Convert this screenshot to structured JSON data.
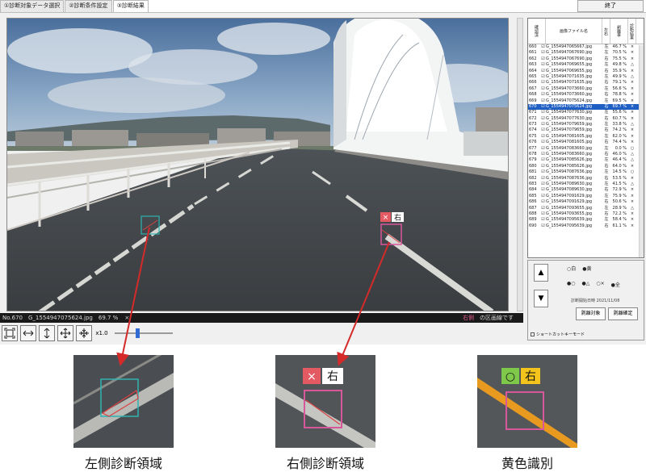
{
  "tabs": [
    "①診断対象データ選択",
    "②診断条件設定",
    "③診断結果"
  ],
  "end_button": "終了",
  "overlay": {
    "label_x": "×",
    "label_side": "右"
  },
  "status": {
    "info": "No.670　G_1554947075624.jpg　69.7 %",
    "close": "×",
    "warn_side": "右側",
    "warn_rest": " の区画線です"
  },
  "toolbar": {
    "zoom_label": "x1.0"
  },
  "list": {
    "headers": [
      "確認済",
      "画像ファイル名",
      "左右",
      "剥離率",
      "診断結果"
    ],
    "rows": [
      {
        "no": "660",
        "file": "G_1554947065667.jpg",
        "side": "左",
        "score": "46.7 %",
        "mark": "×"
      },
      {
        "no": "661",
        "file": "G_1554947067690.jpg",
        "side": "左",
        "score": "70.5 %",
        "mark": "×"
      },
      {
        "no": "662",
        "file": "G_1554947067690.jpg",
        "side": "右",
        "score": "75.5 %",
        "mark": "×"
      },
      {
        "no": "663",
        "file": "G_1554947069655.jpg",
        "side": "左",
        "score": "49.8 %",
        "mark": "△"
      },
      {
        "no": "664",
        "file": "G_1554947069655.jpg",
        "side": "右",
        "score": "35.9 %",
        "mark": "×"
      },
      {
        "no": "665",
        "file": "G_1554947071635.jpg",
        "side": "左",
        "score": "49.9 %",
        "mark": "△"
      },
      {
        "no": "666",
        "file": "G_1554947071635.jpg",
        "side": "右",
        "score": "79.1 %",
        "mark": "×"
      },
      {
        "no": "667",
        "file": "G_1554947073660.jpg",
        "side": "左",
        "score": "56.6 %",
        "mark": "×"
      },
      {
        "no": "668",
        "file": "G_1554947073660.jpg",
        "side": "右",
        "score": "78.8 %",
        "mark": "×"
      },
      {
        "no": "669",
        "file": "G_1554947075624.jpg",
        "side": "左",
        "score": "69.5 %",
        "mark": "×"
      },
      {
        "no": "670",
        "file": "G_1554947075624.jpg",
        "side": "右",
        "score": "69.7 %",
        "mark": "×",
        "selected": true
      },
      {
        "no": "671",
        "file": "G_1554947077630.jpg",
        "side": "左",
        "score": "55.6 %",
        "mark": "×"
      },
      {
        "no": "672",
        "file": "G_1554947077630.jpg",
        "side": "右",
        "score": "60.7 %",
        "mark": "×"
      },
      {
        "no": "673",
        "file": "G_1554947079659.jpg",
        "side": "左",
        "score": "33.8 %",
        "mark": "△"
      },
      {
        "no": "674",
        "file": "G_1554947079659.jpg",
        "side": "右",
        "score": "74.2 %",
        "mark": "×"
      },
      {
        "no": "675",
        "file": "G_1554947081605.jpg",
        "side": "左",
        "score": "62.0 %",
        "mark": "×"
      },
      {
        "no": "676",
        "file": "G_1554947081605.jpg",
        "side": "右",
        "score": "74.4 %",
        "mark": "×"
      },
      {
        "no": "677",
        "file": "G_1554947083660.jpg",
        "side": "左",
        "score": "0.0 %",
        "mark": "○"
      },
      {
        "no": "678",
        "file": "G_1554947083660.jpg",
        "side": "右",
        "score": "46.0 %",
        "mark": "△"
      },
      {
        "no": "679",
        "file": "G_1554947085626.jpg",
        "side": "左",
        "score": "46.4 %",
        "mark": "△"
      },
      {
        "no": "680",
        "file": "G_1554947085626.jpg",
        "side": "右",
        "score": "64.0 %",
        "mark": "×"
      },
      {
        "no": "681",
        "file": "G_1554947087636.jpg",
        "side": "左",
        "score": "14.5 %",
        "mark": "○"
      },
      {
        "no": "682",
        "file": "G_1554947087636.jpg",
        "side": "右",
        "score": "53.5 %",
        "mark": "×"
      },
      {
        "no": "683",
        "file": "G_1554947089630.jpg",
        "side": "左",
        "score": "41.5 %",
        "mark": "△"
      },
      {
        "no": "684",
        "file": "G_1554947089630.jpg",
        "side": "右",
        "score": "72.9 %",
        "mark": "×"
      },
      {
        "no": "685",
        "file": "G_1554947091629.jpg",
        "side": "左",
        "score": "75.9 %",
        "mark": "×"
      },
      {
        "no": "686",
        "file": "G_1554947091629.jpg",
        "side": "右",
        "score": "50.6 %",
        "mark": "×"
      },
      {
        "no": "687",
        "file": "G_1554947093655.jpg",
        "side": "左",
        "score": "28.9 %",
        "mark": "△"
      },
      {
        "no": "688",
        "file": "G_1554947093655.jpg",
        "side": "右",
        "score": "72.2 %",
        "mark": "×"
      },
      {
        "no": "689",
        "file": "G_1554947095639.jpg",
        "side": "左",
        "score": "58.4 %",
        "mark": "×"
      },
      {
        "no": "690",
        "file": "G_1554947095639.jpg",
        "side": "右",
        "score": "61.1 %",
        "mark": "×"
      }
    ]
  },
  "controls": {
    "up": "▲",
    "down": "▼",
    "legend_row1": [
      "○白",
      "●黄"
    ],
    "legend_row2": [
      "●○",
      "●△",
      "○×",
      "●全"
    ],
    "date": "診断開始日時  2021/11/08",
    "btn_target": "剥離対象",
    "btn_confirm": "剥離確定",
    "shortcut": "ショートカットキーモード"
  },
  "captions": {
    "left": "左側診断領域",
    "right": "右側診断領域",
    "yellow": "黄色識別"
  },
  "zoom_labels": {
    "right_x": "×",
    "right_side": "右",
    "yellow_o": "○",
    "yellow_side": "右"
  },
  "colors": {
    "selected_row": "#1f5fc4",
    "arrow": "#d42a2a",
    "region_left": "#2eb3b0",
    "region_right": "#d8569a",
    "badge_red": "#e45a63",
    "badge_green": "#7fc94a",
    "badge_yellow": "#f3c51c"
  }
}
